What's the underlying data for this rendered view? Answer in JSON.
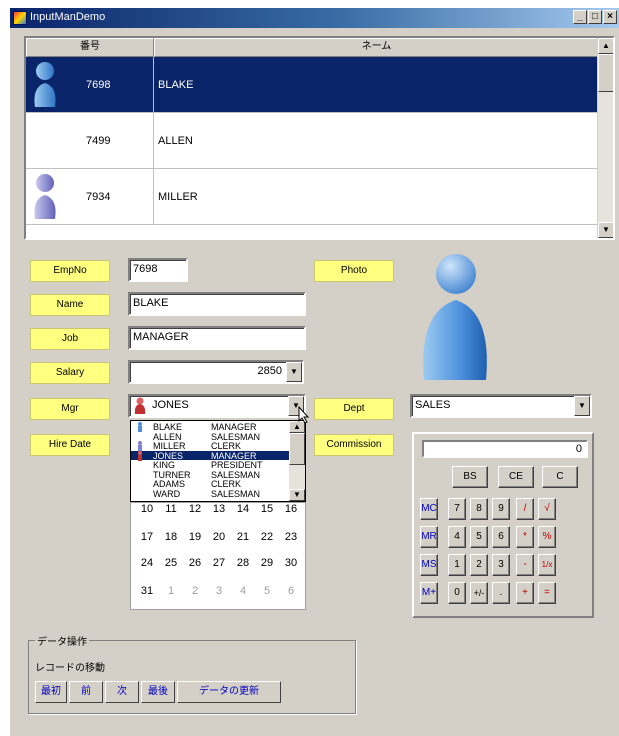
{
  "window": {
    "title": "InputManDemo",
    "min": "_",
    "max": "□",
    "close": "×"
  },
  "grid": {
    "headers": [
      "番号",
      "ネーム"
    ],
    "rows": [
      {
        "number": "7698",
        "name": "BLAKE",
        "selected": true,
        "photo": true
      },
      {
        "number": "7499",
        "name": "ALLEN",
        "selected": false,
        "photo": false
      },
      {
        "number": "7934",
        "name": "MILLER",
        "selected": false,
        "photo": true
      }
    ]
  },
  "form": {
    "empno_label": "EmpNo",
    "empno_value": "7698",
    "name_label": "Name",
    "name_value": "BLAKE",
    "job_label": "Job",
    "job_value": "MANAGER",
    "salary_label": "Salary",
    "salary_value": "2850",
    "mgr_label": "Mgr",
    "mgr_value": "JONES",
    "hiredate_label": "Hire Date",
    "photo_label": "Photo",
    "dept_label": "Dept",
    "dept_value": "SALES",
    "commission_label": "Commission"
  },
  "mgr_list": [
    {
      "name": "BLAKE",
      "job": "MANAGER"
    },
    {
      "name": "ALLEN",
      "job": "SALESMAN"
    },
    {
      "name": "MILLER",
      "job": "CLERK"
    },
    {
      "name": "JONES",
      "job": "MANAGER",
      "selected": true
    },
    {
      "name": "KING",
      "job": "PRESIDENT"
    },
    {
      "name": "TURNER",
      "job": "SALESMAN"
    },
    {
      "name": "ADAMS",
      "job": "CLERK"
    },
    {
      "name": "WARD",
      "job": "SALESMAN"
    }
  ],
  "calendar": {
    "rows": [
      [
        "10",
        "11",
        "12",
        "13",
        "14",
        "15",
        "16"
      ],
      [
        "17",
        "18",
        "19",
        "20",
        "21",
        "22",
        "23"
      ],
      [
        "24",
        "25",
        "26",
        "27",
        "28",
        "29",
        "30"
      ],
      [
        "31",
        "1",
        "2",
        "3",
        "4",
        "5",
        "6"
      ]
    ]
  },
  "calculator": {
    "display": "0",
    "bs": "BS",
    "ce": "CE",
    "c": "C",
    "mc": "MC",
    "mr": "MR",
    "ms": "MS",
    "mplus": "M+",
    "n7": "7",
    "n8": "8",
    "n9": "9",
    "div": "/",
    "sqrt": "√",
    "n4": "4",
    "n5": "5",
    "n6": "6",
    "mul": "*",
    "pct": "%",
    "n1": "1",
    "n2": "2",
    "n3": "3",
    "sub": "-",
    "recip": "1/x",
    "n0": "0",
    "sign": "+/-",
    "dot": ".",
    "add": "+",
    "eq": "="
  },
  "data_ops": {
    "legend": "データ操作",
    "sub": "レコードの移動",
    "first": "最初",
    "prev": "前",
    "next": "次",
    "last": "最後",
    "update": "データの更新"
  }
}
